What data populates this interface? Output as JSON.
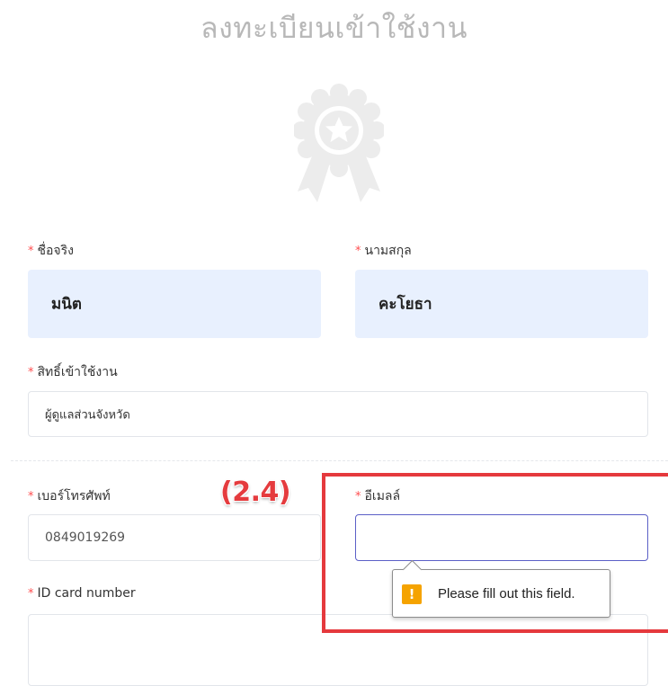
{
  "page": {
    "title": "ลงทะเบียนเข้าใช้งาน"
  },
  "form": {
    "required_mark": "*",
    "first_name": {
      "label": "ชื่อจริง",
      "value": "มนิต"
    },
    "last_name": {
      "label": "นามสกุล",
      "value": "คะโยธา"
    },
    "role": {
      "label": "สิทธิ์เข้าใช้งาน",
      "value": "ผู้ดูแลส่วนจังหวัด"
    },
    "phone": {
      "label": "เบอร์โทรศัพท์",
      "value": "0849019269"
    },
    "email": {
      "label": "อีเมลล์",
      "value": ""
    },
    "id_card": {
      "label": "ID card number",
      "value": ""
    }
  },
  "annotation": {
    "label": "(2.4)",
    "color": "#e5393d"
  },
  "validation_tooltip": {
    "icon": "warning-icon",
    "message": "Please fill out this field."
  },
  "colors": {
    "required": "#ff4d4f",
    "filled_bg": "#e8f0fe",
    "focus_border": "#5b5fc7"
  }
}
